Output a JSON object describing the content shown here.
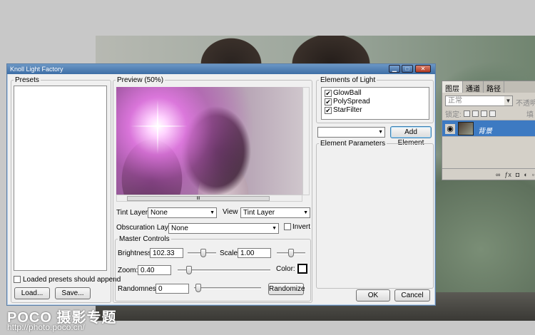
{
  "photoshop": {
    "layers_panel": {
      "tabs": [
        "图层",
        "通道",
        "路径"
      ],
      "blend_mode": "正常",
      "opacity_label": "不透明度",
      "lock_label": "锁定:",
      "fill_label": "填充",
      "layer_name": "背景"
    }
  },
  "dialog": {
    "title": "Knoll Light Factory",
    "presets": {
      "legend": "Presets",
      "append_label": "Loaded presets should append",
      "load_label": "Load...",
      "save_label": "Save..."
    },
    "preview": {
      "legend": "Preview (50%)",
      "scroll_grip": "III"
    },
    "tint_layer": {
      "label": "Tint Layer",
      "value": "None"
    },
    "view": {
      "label": "View",
      "value": "Tint Layer"
    },
    "obscuration_layer": {
      "label": "Obscuration Layer",
      "value": "None"
    },
    "invert_label": "Invert",
    "master_controls": {
      "legend": "Master Controls",
      "brightness_label": "Brightness:",
      "brightness_value": "102.33",
      "scale_label": "Scale:",
      "scale_value": "1.00",
      "zoom_label": "Zoom:",
      "zoom_value": "0.40",
      "color_label": "Color:",
      "randomness_label": "Randomness:",
      "randomness_value": "0",
      "randomize_label": "Randomize"
    },
    "elements": {
      "legend": "Elements of Light",
      "items": [
        {
          "label": "GlowBall",
          "checked": "✔"
        },
        {
          "label": "PolySpread",
          "checked": "✔"
        },
        {
          "label": "StarFilter",
          "checked": "✔"
        }
      ],
      "dropdown_value": "",
      "add_label": "Add Element"
    },
    "parameters": {
      "legend": "Element Parameters"
    },
    "ok_label": "OK",
    "cancel_label": "Cancel"
  },
  "watermark": {
    "brand": "POCO 摄影专题",
    "url": "http://photo.poco.cn/"
  }
}
